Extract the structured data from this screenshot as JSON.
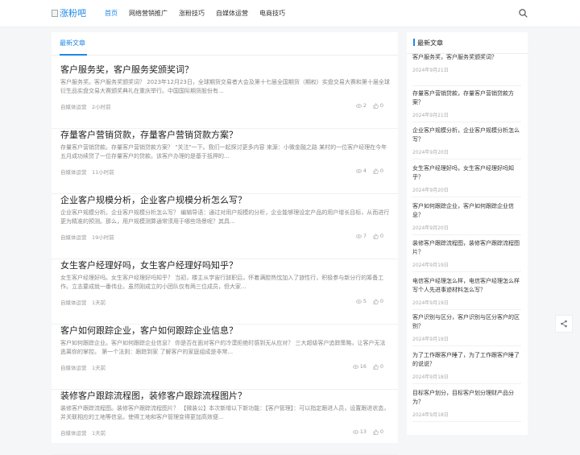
{
  "header": {
    "logo_text": "涨粉吧",
    "nav": [
      "首页",
      "网络营销推广",
      "涨粉技巧",
      "自媒体运营",
      "电商技巧"
    ]
  },
  "main": {
    "section_title": "最新文章",
    "articles": [
      {
        "title": "客户服务奖，客户服务奖颁奖词？",
        "excerpt": "客户服务奖。客户服务奖颁奖词？ 2023年12月23日，全球期货交易者大会及第十七届全国期货（期权）实盘交易大赛和第十届全球衍生品实盘交易大赛颁奖典礼在重庆举行。中国国际期货股份有...",
        "category": "自媒体运营",
        "time": "2小时前",
        "views": "2",
        "likes": "0"
      },
      {
        "title": "存量客户营销贷款，存量客户营销贷款方案？",
        "excerpt": "存量客户营销贷款。存量客户营销贷款方案？ \"关注\"一下。我们一起探讨更多内容 来源：小微金融之路 某村的一位客户经理在今年五月成功续贷了一位存量客户的贷款。该客户办理的是基于抵押的...",
        "category": "自媒体运营",
        "time": "11小时前",
        "views": "4",
        "likes": "0"
      },
      {
        "title": "企业客户规模分析，企业客户规模分析怎么写？",
        "excerpt": "企业客户规模分析。企业客户规模分析怎么写？ 编辑导语：通过对用户规模的分析，企业能够理设定产品的用户增长目标，从而进行更为精准的预测。那么，用户规模测算通常须用于哪些场景呢？其具...",
        "category": "自媒体运营",
        "time": "19小时前",
        "views": "7",
        "likes": "0"
      },
      {
        "title": "女生客户经理好吗，女生客户经理好吗知乎？",
        "excerpt": "女生客户经理好吗。女生客户经理好吗知乎？ 当初，楼主从学宙行辞职后，怀着满腔热忱加入了旅性行，积极参与新分行的筹备工作。立志要成就一番伟业。虽然刚成立的小团队仅有两三位成员，但大家...",
        "category": "自媒体运营",
        "time": "1天前",
        "views": "5",
        "likes": "0"
      },
      {
        "title": "客户如何跟踪企业，客户如何跟踪企业信息？",
        "excerpt": "客户如何跟踪企业。客户如何跟踪企业信息？ 你是否在面对客户的冷漠拒绝时感到无从应对？ 三大超级客户追踪策略，让客户无法逃离你的掌控。 第一个法则：跟踪到家 了解客户的家庭组成是非常...",
        "category": "自媒体运营",
        "time": "1天前",
        "views": "16",
        "likes": "0"
      },
      {
        "title": "装修客户跟踪流程图，装修客户跟踪流程图片？",
        "excerpt": "装修客户跟踪流程图。装修客户跟踪流程图片？ 【微装公】本次新增以下新功能：【客户管理】：可以指定跟进人员，设置跟进状态，并关联相应的工地等信息。使得工地和客户管理变得更加高效便...",
        "category": "自媒体运营",
        "time": "1天前",
        "views": "13",
        "likes": "0"
      }
    ]
  },
  "sidebar": {
    "title": "最新文章",
    "items": [
      {
        "title": "客户服务奖，客户服务奖颁奖词？",
        "date": "2024年9月21日"
      },
      {
        "title": "存量客户营销贷款，存量客户营销贷款方案？",
        "date": "2024年9月21日"
      },
      {
        "title": "企业客户规模分析，企业客户规模分析怎么写？",
        "date": "2024年9月20日"
      },
      {
        "title": "女生客户经理好吗，女生客户经理好吗知乎？",
        "date": "2024年9月20日"
      },
      {
        "title": "客户如何跟踪企业，客户如何跟踪企业信息？",
        "date": "2024年9月20日"
      },
      {
        "title": "装修客户跟踪流程图，装修客户跟踪流程图片？",
        "date": "2024年9月19日"
      },
      {
        "title": "电信客户经理怎么样，电信客户经理怎么样写个人先进事迹材料怎么写？",
        "date": "2024年9月19日"
      },
      {
        "title": "客户识别与区分，客户识别与区分客户的区别？",
        "date": "2024年9月19日"
      },
      {
        "title": "为了工作跟客户睡了，为了工作跟客户睡了的说说？",
        "date": "2024年9月18日"
      },
      {
        "title": "目标客户划分，目标客户划分理财产品分为？",
        "date": "2024年9月18日"
      }
    ]
  },
  "colors": {
    "accent": "#1e88e5",
    "background": "#f5f6f7"
  },
  "icons": {
    "search": "search-icon",
    "views": "eye-icon",
    "likes": "thumbs-up-icon",
    "share": "share-icon"
  }
}
